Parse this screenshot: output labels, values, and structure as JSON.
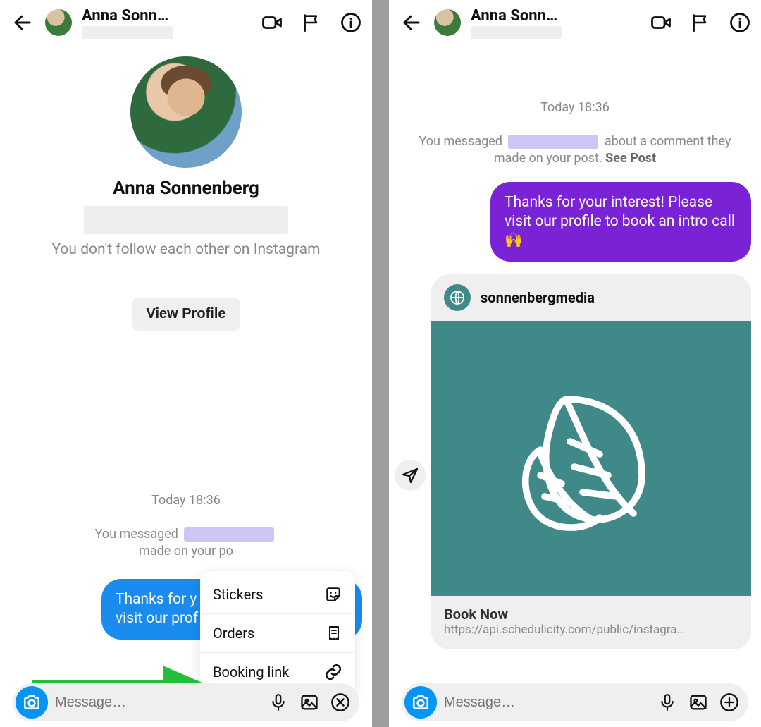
{
  "left": {
    "header": {
      "title": "Anna Sonn…"
    },
    "profile": {
      "name": "Anna Sonnenberg",
      "follow_note": "You don't follow each other on Instagram",
      "view_profile_label": "View Profile"
    },
    "timestamp": "Today 18:36",
    "system_message": {
      "prefix": "You messaged",
      "suffix": "made on your po"
    },
    "bubble_text": "Thanks for y\nvisit our prof",
    "popup": {
      "stickers": "Stickers",
      "orders": "Orders",
      "booking": "Booking link"
    },
    "input_placeholder": "Message…"
  },
  "right": {
    "header": {
      "title": "Anna Sonn…"
    },
    "timestamp": "Today 18:36",
    "system_message": {
      "prefix": "You messaged",
      "middle": "about a comment they made on your post.",
      "see_post": "See Post"
    },
    "bubble_text": "Thanks for your interest! Please visit our profile to book an intro call 🙌",
    "card": {
      "brand": "sonnenbergmedia",
      "cta": "Book Now",
      "url": "https://api.schedulicity.com/public/instagra…"
    },
    "input_placeholder": "Message…"
  }
}
